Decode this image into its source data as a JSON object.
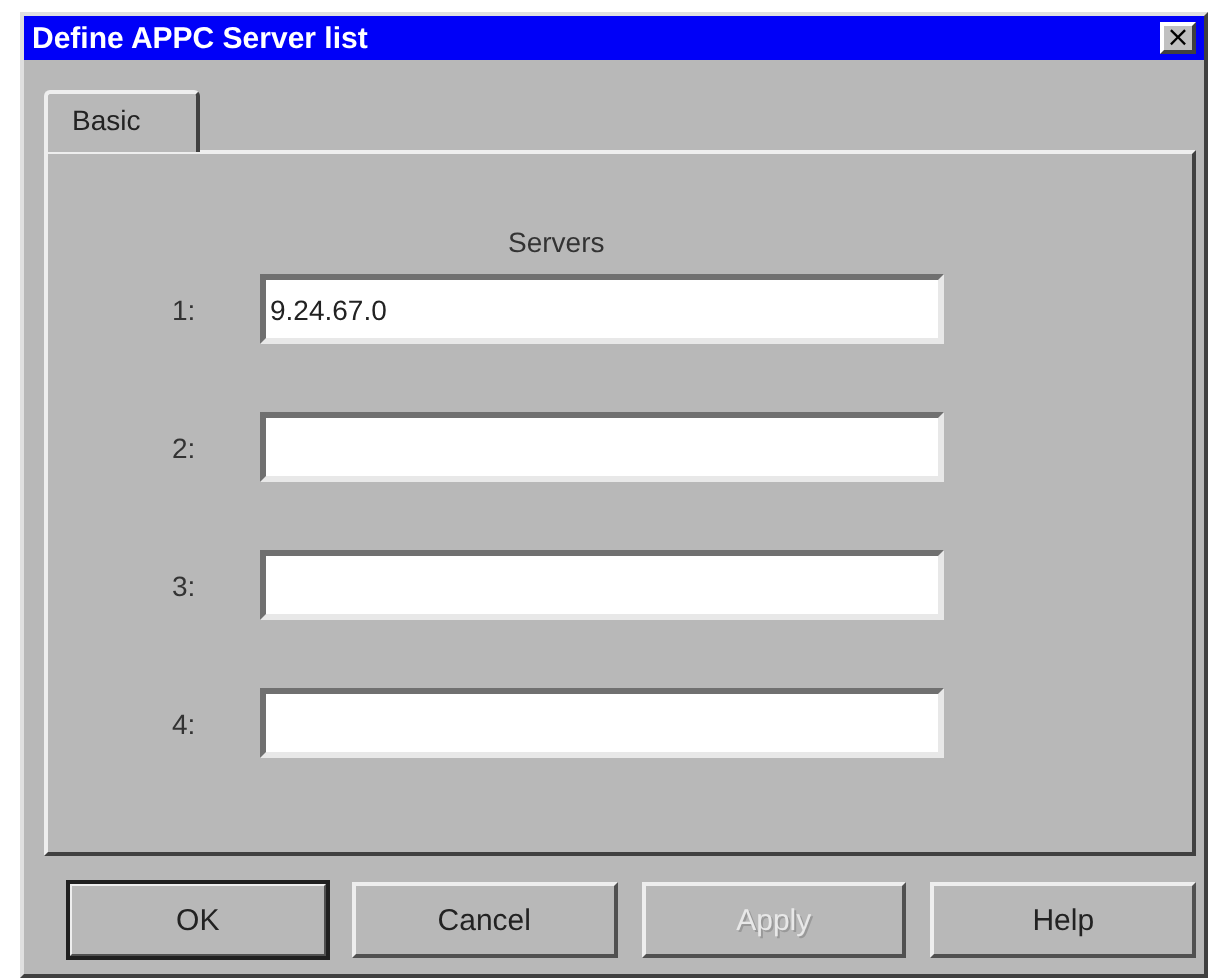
{
  "window": {
    "title": "Define APPC Server list",
    "close": "×"
  },
  "tabs": [
    {
      "label": "Basic",
      "selected": true
    }
  ],
  "servers_heading": "Servers",
  "servers": [
    {
      "label": "1:",
      "value": "9.24.67.0"
    },
    {
      "label": "2:"
    },
    {
      "label": "3:"
    },
    {
      "label": "4:"
    }
  ],
  "buttons": [
    {
      "label": "OK",
      "default": true,
      "disabled": false
    },
    {
      "label": "Cancel",
      "default": false,
      "disabled": false
    },
    {
      "label": "Apply",
      "default": false,
      "disabled": true
    },
    {
      "label": "Help",
      "default": false,
      "disabled": false
    }
  ]
}
